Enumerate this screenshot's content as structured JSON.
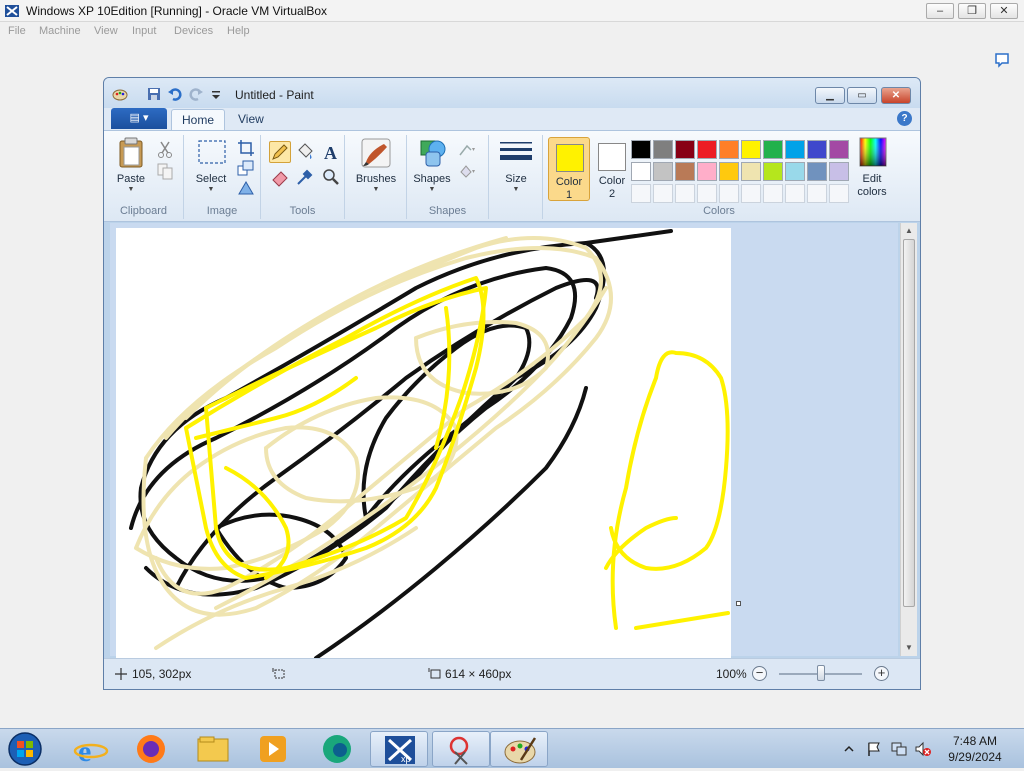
{
  "vbox": {
    "title": "Windows XP 10Edition [Running] - Oracle VM VirtualBox",
    "menu": [
      "File",
      "Machine",
      "View",
      "Input",
      "Devices",
      "Help"
    ]
  },
  "paint": {
    "title": "Untitled - Paint",
    "tabs": [
      "Home",
      "View"
    ],
    "groups": {
      "clipboard": {
        "label": "Clipboard",
        "paste": "Paste"
      },
      "image": {
        "label": "Image",
        "select": "Select"
      },
      "tools": {
        "label": "Tools"
      },
      "brushes": {
        "label": "Brushes"
      },
      "shapes": {
        "label": "Shapes",
        "shapes": "Shapes"
      },
      "size": {
        "label": "Size"
      },
      "colors": {
        "label": "Colors",
        "color1_l1": "Color",
        "color1_l2": "1",
        "color2_l1": "Color",
        "color2_l2": "2",
        "edit_l1": "Edit",
        "edit_l2": "colors"
      }
    },
    "palette_row1": [
      "#000000",
      "#7f7f7f",
      "#880015",
      "#ed1c24",
      "#ff7f27",
      "#fff200",
      "#22b14c",
      "#00a2e8",
      "#3f48cc",
      "#a349a4"
    ],
    "palette_row2": [
      "#ffffff",
      "#c3c3c3",
      "#b97a57",
      "#ffaec9",
      "#ffc90e",
      "#efe4b0",
      "#b5e61d",
      "#99d9ea",
      "#7092be",
      "#c8bfe7"
    ],
    "color1": "#fff200",
    "color2": "#ffffff",
    "status": {
      "cursor_pos": "105, 302px",
      "canvas_size": "614 × 460px",
      "zoom": "100%",
      "zoom_level": 0.5
    }
  },
  "taskbar": {
    "time": "7:48 AM",
    "date": "9/29/2024",
    "apps": [
      "start-orb",
      "internet-explorer-icon",
      "firefox-icon",
      "file-explorer-icon",
      "media-player-icon",
      "edge-icon",
      "xp-virtualbox-icon",
      "snipping-tool-icon",
      "paint-icon"
    ]
  }
}
